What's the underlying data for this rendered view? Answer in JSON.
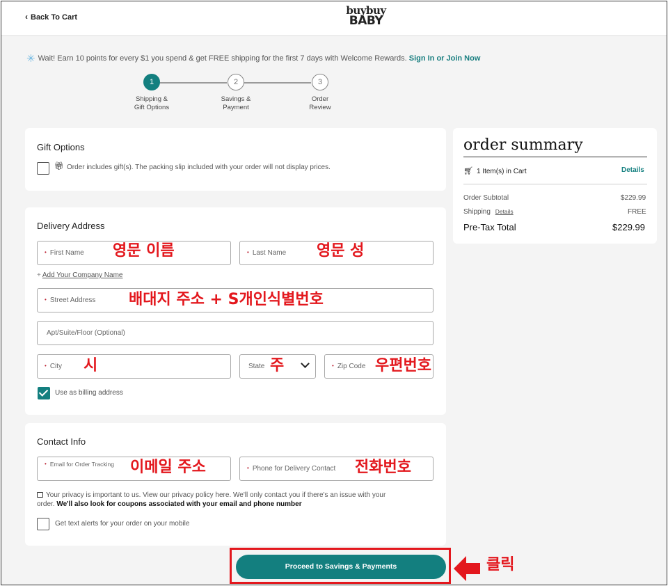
{
  "header": {
    "back_label": "Back To Cart",
    "logo_line1": "buybuy",
    "logo_line2": "BABY"
  },
  "promo": {
    "text": "Wait! Earn 10 points for every $1 you spend & get FREE shipping for the first 7 days with Welcome Rewards.",
    "link": "Sign In or Join Now"
  },
  "steps": [
    {
      "num": "1",
      "label1": "Shipping &",
      "label2": "Gift Options"
    },
    {
      "num": "2",
      "label1": "Savings &",
      "label2": "Payment"
    },
    {
      "num": "3",
      "label1": "Order",
      "label2": "Review"
    }
  ],
  "gift": {
    "title": "Gift Options",
    "checkbox_label": "Order includes gift(s). The packing slip included with your order will not display prices."
  },
  "delivery": {
    "title": "Delivery Address",
    "first_name": "First Name",
    "last_name": "Last Name",
    "add_company": "Add Your Company Name",
    "street": "Street Address",
    "apt": "Apt/Suite/Floor (Optional)",
    "city": "City",
    "state": "State",
    "zip": "Zip Code",
    "billing_label": "Use as billing address"
  },
  "contact": {
    "title": "Contact Info",
    "email": "Email for Order Tracking",
    "phone": "Phone for Delivery Contact",
    "privacy_text": "Your privacy is important to us. View our privacy policy here. We'll only contact you if there's an issue with your",
    "privacy_text2": "order.",
    "privacy_bold": "We'll also look for coupons associated with your email and phone number",
    "text_alerts": "Get text alerts for your order on your mobile"
  },
  "summary": {
    "title": "order summary",
    "items_in_cart": "1 Item(s) in Cart",
    "details": "Details",
    "subtotal_label": "Order Subtotal",
    "subtotal_value": "$229.99",
    "shipping_label": "Shipping",
    "shipping_details": "Details",
    "shipping_value": "FREE",
    "pretax_label": "Pre-Tax Total",
    "pretax_value": "$229.99"
  },
  "proceed_label": "Proceed to Savings & Payments",
  "annotations": {
    "first_name": "영문 이름",
    "last_name": "영문 성",
    "street": "배대지 주소 + S개인식별번호",
    "city": "시",
    "state": "주",
    "zip": "우편번호",
    "email": "이메일 주소",
    "phone": "전화번호",
    "click": "클릭"
  },
  "colors": {
    "brand_teal": "#137f7f",
    "annotation_red": "#e3171d"
  }
}
